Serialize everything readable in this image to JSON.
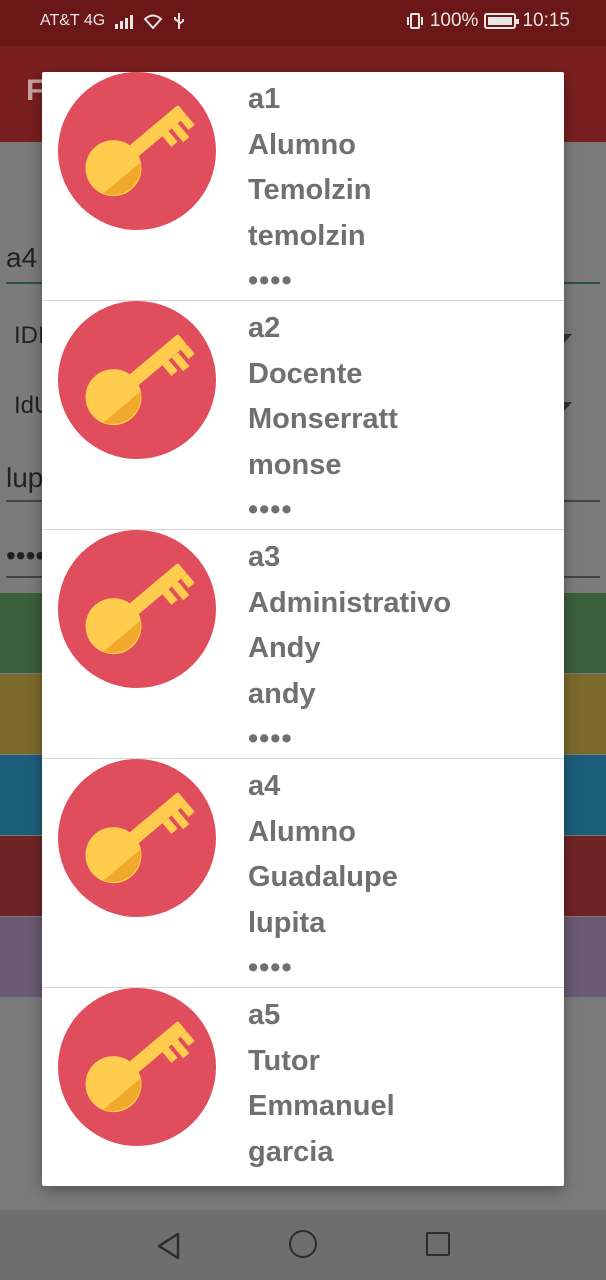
{
  "status_bar": {
    "carrier": "AT&T 4G",
    "battery": "100%",
    "time": "10:15"
  },
  "background": {
    "app_title": "F",
    "id_field_value": "a4",
    "dropdown_1_label": "IDI",
    "dropdown_2_label": "IdU",
    "name_field_value": "lup",
    "password_field_value": "••••",
    "band_colors": [
      "#3b5f3b",
      "#7b6a2c",
      "#1d5f7a",
      "#6e2424",
      "#6b5a72"
    ]
  },
  "dialog": {
    "items": [
      {
        "id": "a1",
        "role": "Alumno",
        "name": "Temolzin",
        "user": "temolzin",
        "password": "••••"
      },
      {
        "id": "a2",
        "role": "Docente",
        "name": "Monserratt",
        "user": "monse",
        "password": "••••"
      },
      {
        "id": "a3",
        "role": "Administrativo",
        "name": "Andy",
        "user": "andy",
        "password": "••••"
      },
      {
        "id": "a4",
        "role": "Alumno",
        "name": "Guadalupe",
        "user": "lupita",
        "password": "••••"
      },
      {
        "id": "a5",
        "role": "Tutor",
        "name": "Emmanuel",
        "user": "garcia",
        "password": ""
      }
    ],
    "avatar_icon": "key-icon",
    "colors": {
      "avatar_bg": "#e04e5e",
      "key": "#ffcc4d",
      "key_shade": "#f1a92c",
      "text": "#707070"
    }
  }
}
